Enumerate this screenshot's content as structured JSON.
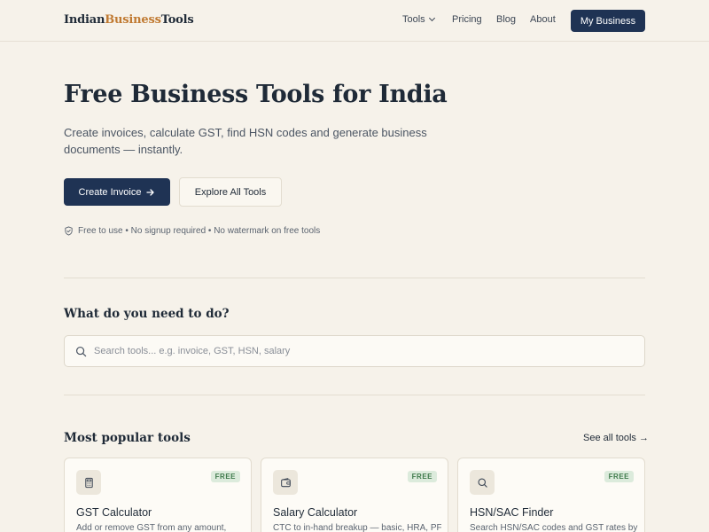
{
  "brand": {
    "part1": "Indian",
    "part2": "Business",
    "part3": "Tools",
    "accent_color": "#c07a32"
  },
  "nav": {
    "tools": "Tools",
    "pricing": "Pricing",
    "blog": "Blog",
    "about": "About",
    "my_business": "My Business"
  },
  "hero": {
    "title": "Free Business Tools for India",
    "subtitle": "Create invoices, calculate GST, find HSN codes and generate business documents — instantly.",
    "primary_cta": "Create Invoice",
    "secondary_cta": "Explore All Tools",
    "trust_text": "Free to use • No signup required • No watermark on free tools"
  },
  "search": {
    "heading": "What do you need to do?",
    "placeholder": "Search tools... e.g. invoice, GST, HSN, salary",
    "value": ""
  },
  "popular": {
    "heading": "Most popular tools",
    "see_all": "See all tools →",
    "cards": [
      {
        "icon": "calculator-icon",
        "badge": "FREE",
        "title": "GST Calculator",
        "desc": "Add or remove GST from any amount,"
      },
      {
        "icon": "wallet-icon",
        "badge": "FREE",
        "title": "Salary Calculator",
        "desc": "CTC to in-hand breakup — basic, HRA, PF,"
      },
      {
        "icon": "search-icon",
        "badge": "FREE",
        "title": "HSN/SAC Finder",
        "desc": "Search HSN/SAC codes and GST rates by"
      }
    ]
  },
  "colors": {
    "primary": "#1f3354",
    "background": "#f6f2ea",
    "badge_bg": "#dcebdc",
    "badge_text": "#3f7a4b"
  }
}
